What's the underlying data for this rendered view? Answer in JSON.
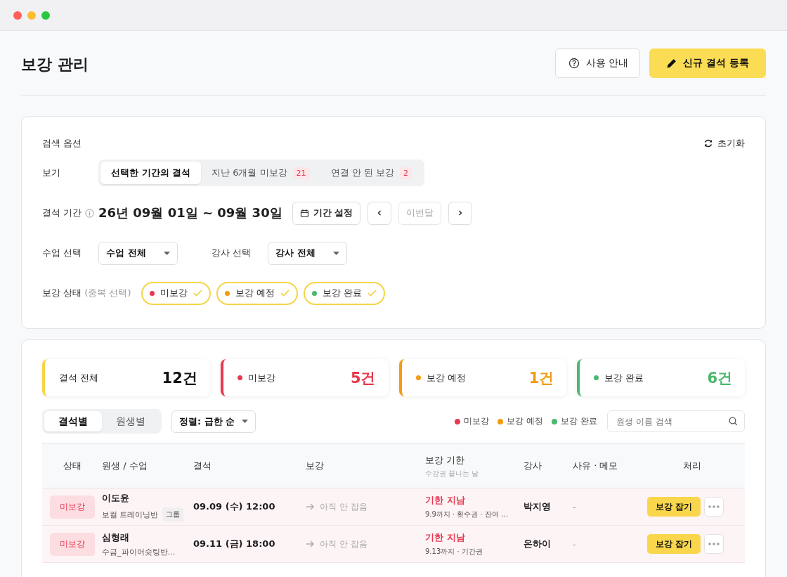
{
  "page": {
    "title": "보강 관리",
    "help_button": "사용 안내",
    "primary_button": "신규 결석 등록"
  },
  "search": {
    "title": "검색 옵션",
    "reset": "초기화",
    "view_label": "보기",
    "view_tabs": [
      {
        "label": "선택한 기간의 결석",
        "selected": true
      },
      {
        "label": "지난 6개월 미보강",
        "count": "21",
        "selected": false
      },
      {
        "label": "연결 안 된 보강",
        "count": "2",
        "selected": false
      }
    ],
    "period_label": "결석 기간",
    "period": "26년 09월 01일 ~ 09월 30일",
    "period_button": "기간 설정",
    "this_month": "이번달",
    "this_month_disabled": true,
    "class_label": "수업 선택",
    "class_value": "수업 전체",
    "teacher_label": "강사 선택",
    "teacher_value": "강사 전체",
    "status_label": "보강 상태",
    "status_hint": "(중복 선택)",
    "status_chips": [
      {
        "label": "미보강",
        "color": "#e8384f",
        "checked": true
      },
      {
        "label": "보강 예정",
        "color": "#f39c12",
        "checked": true
      },
      {
        "label": "보강 완료",
        "color": "#4cb86e",
        "checked": true
      }
    ]
  },
  "stats": [
    {
      "label": "결석 전체",
      "value": "12건",
      "color": "#f5d547",
      "dot": false
    },
    {
      "label": "미보강",
      "value": "5건",
      "color": "#e8384f",
      "dot": true
    },
    {
      "label": "보강 예정",
      "value": "1건",
      "color": "#f39c12",
      "dot": true
    },
    {
      "label": "보강 완료",
      "value": "6건",
      "color": "#4cb86e",
      "dot": true
    }
  ],
  "list_tabs": [
    {
      "label": "결석별",
      "selected": true
    },
    {
      "label": "원생별",
      "selected": false
    }
  ],
  "sort": "정렬: 급한 순",
  "legend": [
    {
      "label": "미보강",
      "color": "#e8384f"
    },
    {
      "label": "보강 예정",
      "color": "#f39c12"
    },
    {
      "label": "보강 완료",
      "color": "#4cb86e"
    }
  ],
  "search_placeholder": "원생 이름 검색",
  "table": {
    "columns": [
      {
        "label": "상태"
      },
      {
        "label": "원생 / 수업"
      },
      {
        "label": "결석"
      },
      {
        "label": "보강"
      },
      {
        "label": "보강 기한",
        "sub": "수강권 끝나는 날"
      },
      {
        "label": "강사"
      },
      {
        "label": "사유 · 메모"
      },
      {
        "label": "처리"
      }
    ],
    "rows": [
      {
        "kind": "missed",
        "status": "미보강",
        "student": "이도윤",
        "class": "보컬 트레이닝반",
        "tag": "그룹",
        "absence": "09.09 (수) 12:00",
        "makeup": "아직 안 잡음",
        "deadline": "기한 지남",
        "deadline_detail": "9.9까지 · 횟수권 · 잔여 …",
        "teacher": "박지영",
        "memo": "-",
        "action": "보강 잡기"
      },
      {
        "kind": "missed",
        "status": "미보강",
        "student": "심형래",
        "class": "수금_파이어슛팅반…",
        "absence": "09.11 (금) 18:00",
        "makeup": "아직 안 잡음",
        "deadline": "기한 지남",
        "deadline_detail": "9.13까지 · 기간권",
        "teacher": "온하이",
        "memo": "-",
        "action": "보강 잡기"
      }
    ]
  }
}
